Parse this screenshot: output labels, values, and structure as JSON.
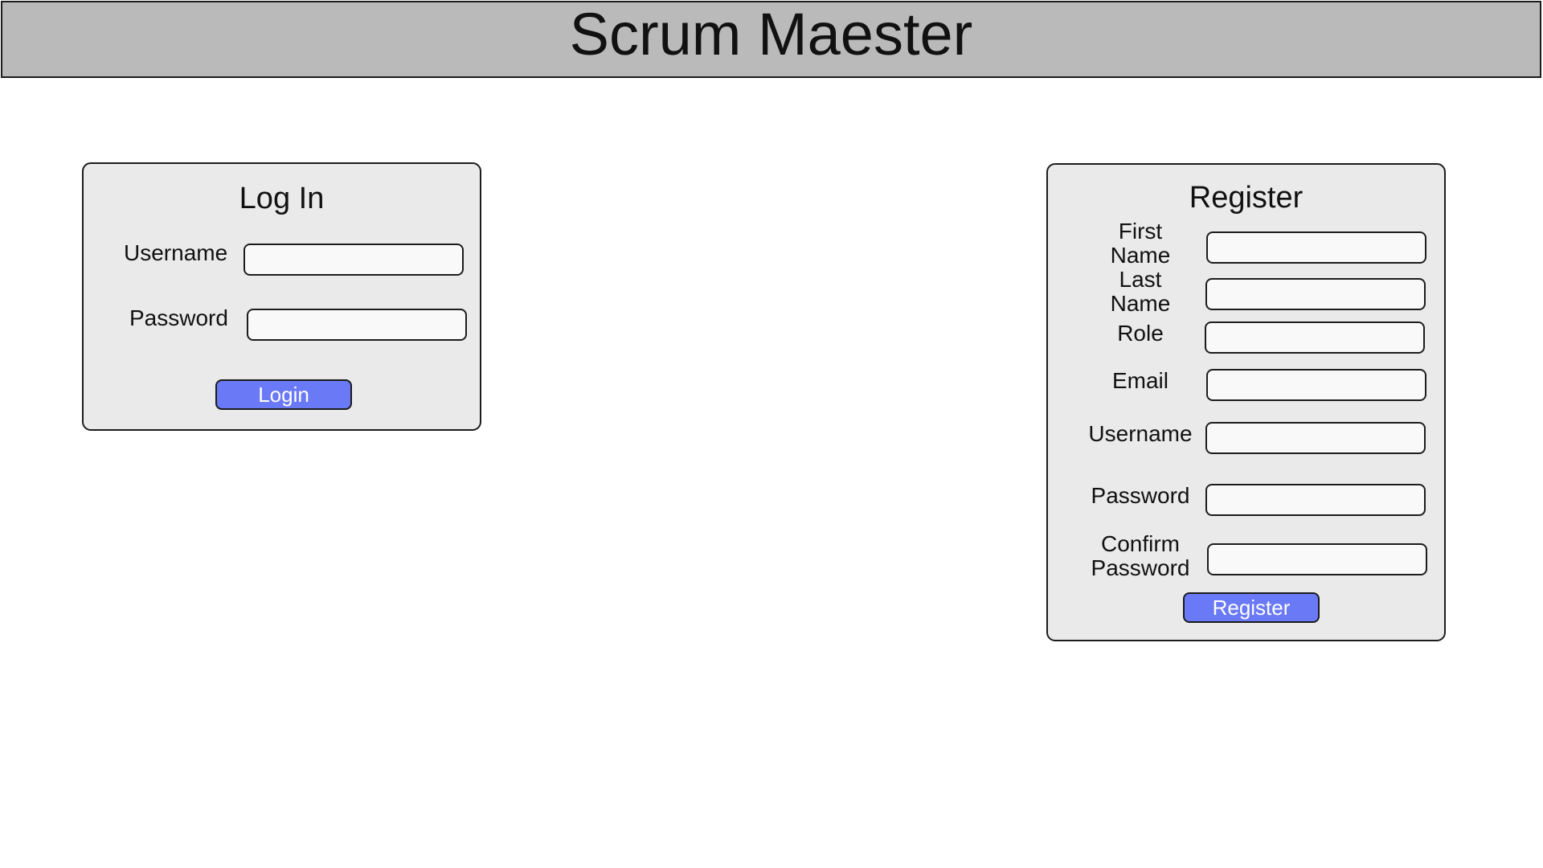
{
  "app": {
    "title": "Scrum Maester"
  },
  "login": {
    "title": "Log In",
    "username_label": "Username",
    "username_value": "",
    "password_label": "Password",
    "password_value": "",
    "submit_label": "Login"
  },
  "register": {
    "title": "Register",
    "first_name_label": "First Name",
    "first_name_value": "",
    "last_name_label": "Last Name",
    "last_name_value": "",
    "role_label": "Role",
    "role_value": "",
    "email_label": "Email",
    "email_value": "",
    "username_label": "Username",
    "username_value": "",
    "password_label": "Password",
    "password_value": "",
    "confirm_password_label": "Confirm Password",
    "confirm_password_value": "",
    "submit_label": "Register"
  },
  "colors": {
    "header_bg": "#bababa",
    "panel_bg": "#eaeaea",
    "button_bg": "#6a79f5",
    "border": "#1c1c1c"
  }
}
